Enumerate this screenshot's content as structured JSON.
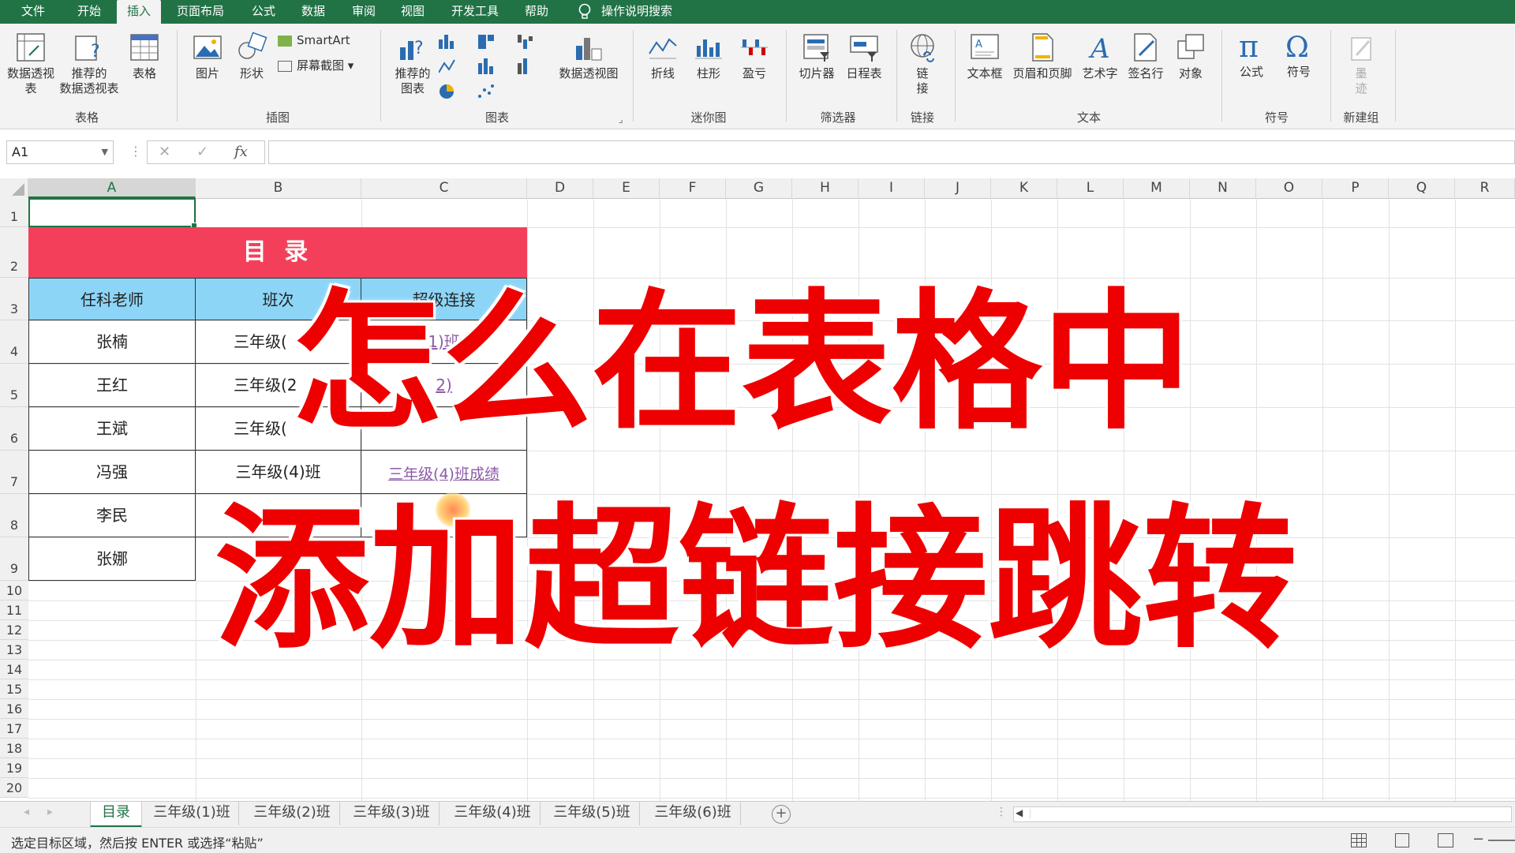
{
  "ribbon_tabs": [
    "文件",
    "开始",
    "插入",
    "页面布局",
    "公式",
    "数据",
    "审阅",
    "视图",
    "开发工具",
    "帮助"
  ],
  "active_tab": "插入",
  "search_label": "操作说明搜索",
  "ribbon": {
    "table_group": {
      "btn1": "数据透视表",
      "btn1b": "视表",
      "btn2": "推荐的",
      "btn2b": "数据透视表",
      "btn3": "表格",
      "label": "表格"
    },
    "illus_group": {
      "pic": "图片",
      "shape": "形状",
      "smartart": "SmartArt",
      "screenshot": "屏幕截图",
      "label": "插图"
    },
    "charts_group": {
      "rec1": "推荐的",
      "rec2": "图表",
      "pivotchart": "数据透视图",
      "label": "图表"
    },
    "spark_group": {
      "line": "折线",
      "column": "柱形",
      "winloss": "盈亏",
      "label": "迷你图"
    },
    "filter_group": {
      "slicer": "切片器",
      "timeline": "日程表",
      "label": "筛选器"
    },
    "link_group": {
      "link1": "链",
      "link2": "接",
      "label": "链接"
    },
    "text_group": {
      "textbox": "文本框",
      "header": "页眉和页脚",
      "wordart": "艺术字",
      "sigline": "签名行",
      "object": "对象",
      "label": "文本"
    },
    "symbol_group": {
      "equation": "公式",
      "symbol": "符号",
      "label": "符号"
    },
    "new_group": {
      "b1": "墨",
      "b2": "迹",
      "label": "新建组"
    }
  },
  "name_box": "A1",
  "fx_label": "fx",
  "columns": [
    "A",
    "B",
    "C",
    "D",
    "E",
    "F",
    "G",
    "H",
    "I",
    "J",
    "K",
    "L",
    "M",
    "N",
    "O",
    "P",
    "Q",
    "R"
  ],
  "rows": [
    "1",
    "2",
    "3",
    "4",
    "5",
    "6",
    "7",
    "8",
    "9",
    "10",
    "11",
    "12",
    "13",
    "14",
    "15",
    "16",
    "17",
    "18",
    "19",
    "20"
  ],
  "table": {
    "title": "目  录",
    "headers": [
      "任科老师",
      "班次",
      "超级连接"
    ],
    "teachers": [
      "张楠",
      "王红",
      "王斌",
      "冯强",
      "李民",
      "张娜"
    ],
    "classes": [
      "三年级(",
      "三年级(2",
      "三年级(",
      "三年级(4)班",
      "",
      ""
    ],
    "links": [
      "1)班",
      "2)",
      "",
      "三年级(4)班成绩",
      "",
      ""
    ]
  },
  "overlay": {
    "line1": "怎么在表格中",
    "line2": "添加超链接跳转"
  },
  "sheet_tabs": [
    "目录",
    "三年级(1)班",
    "三年级(2)班",
    "三年级(3)班",
    "三年级(4)班",
    "三年级(5)班",
    "三年级(6)班"
  ],
  "active_sheet": "目录",
  "status_text": "选定目标区域，然后按 ENTER 或选择“粘贴”",
  "colors": {
    "title_bg": "#f43f5b",
    "header_bg": "#8dd5f7",
    "excel_green": "#217346",
    "overlay_red": "#ee0000",
    "link_purple": "#8e5aa8"
  }
}
